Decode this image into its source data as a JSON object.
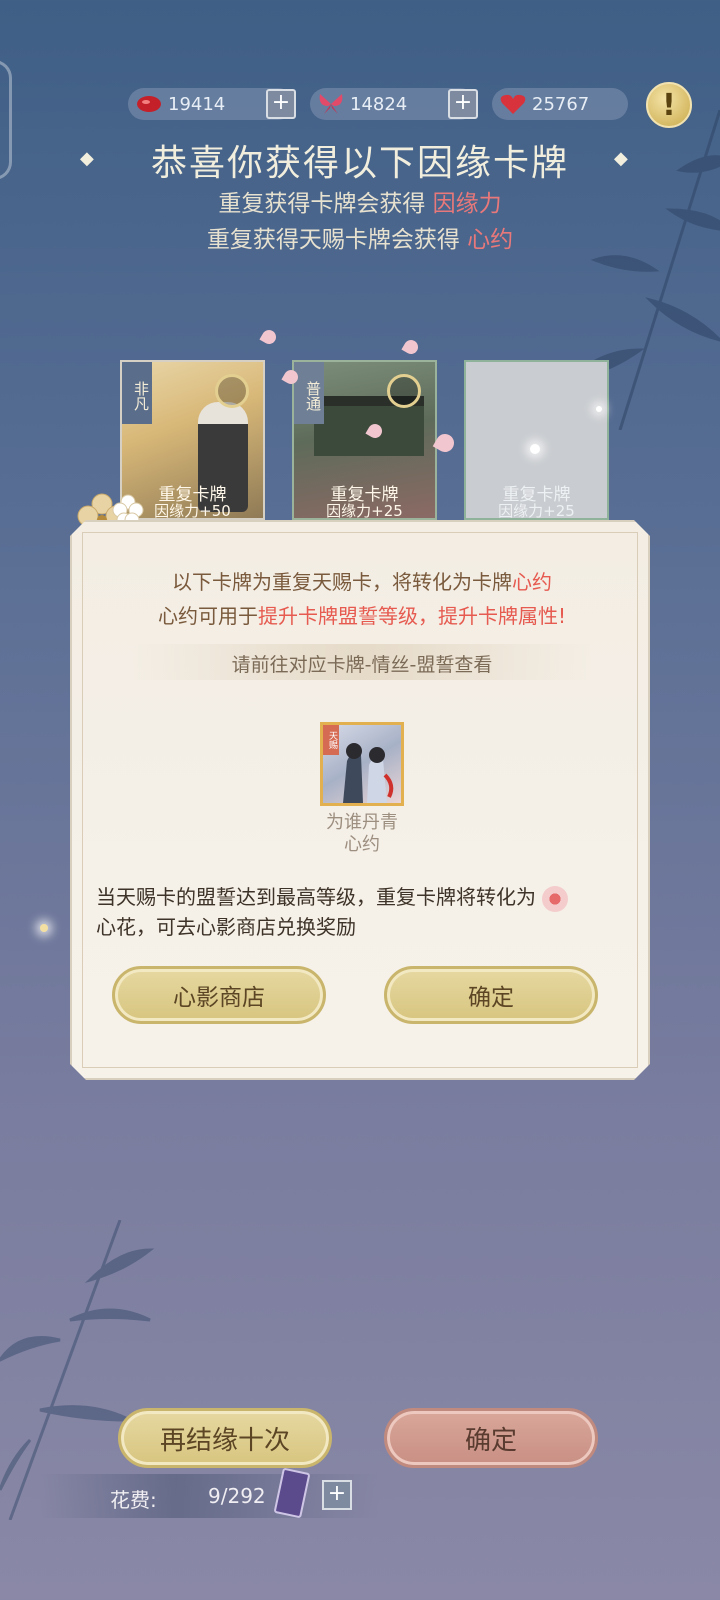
{
  "currencies": [
    {
      "icon": "red-bean-icon",
      "value": "19414"
    },
    {
      "icon": "butterfly-icon",
      "value": "14824"
    },
    {
      "icon": "heart-icon",
      "value": "25767"
    }
  ],
  "currency_plus": "+",
  "alert": "!",
  "header": {
    "title": "恭喜你获得以下因缘卡牌",
    "line1_prefix": "重复获得卡牌会获得",
    "line1_highlight": "因缘力",
    "line2_prefix": "重复获得天赐卡牌会获得",
    "line2_highlight": "心约",
    "diamond": "◆"
  },
  "cards": [
    {
      "rarity": "非凡",
      "title": "重复卡牌",
      "amount": "因缘力+50"
    },
    {
      "rarity": "普通",
      "title": "重复卡牌",
      "amount": "因缘力+25"
    },
    {
      "rarity": "",
      "title": "重复卡牌",
      "amount": "因缘力+25"
    }
  ],
  "dialog": {
    "line1_prefix": "以下卡牌为重复天赐卡，将转化为卡牌",
    "line1_highlight": "心约",
    "line2_prefix": "心约可用于",
    "line2_highlight": "提升卡牌盟誓等级，提升卡牌属性!",
    "hint": "请前往对应卡牌-情丝-盟誓查看",
    "reward_tag": "天赐",
    "reward_name": "为谁丹青",
    "reward_type": "心约",
    "note_part1": "当天赐卡的盟誓达到最高等级，重复卡牌将转化为",
    "note_part2": "心花，可去心影商店兑换奖励",
    "shop_button": "心影商店",
    "confirm_button": "确定"
  },
  "bottom": {
    "again_button": "再结缘十次",
    "confirm_button": "确定",
    "cost_label": "花费:",
    "cost_value": "9/292",
    "cost_plus": "+"
  },
  "colors": {
    "highlight_red": "#e65a4f",
    "gold_button": "#d7c57f",
    "pink_button": "#c98f84"
  }
}
